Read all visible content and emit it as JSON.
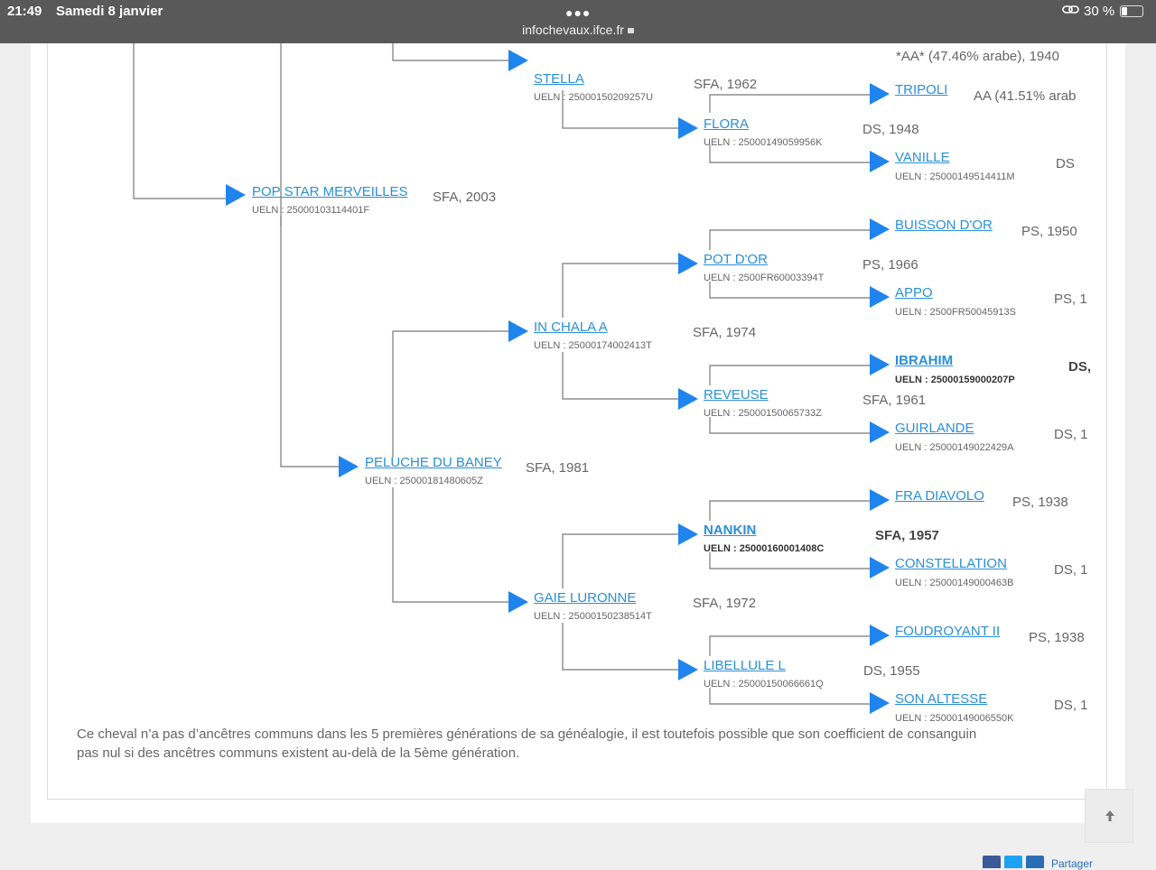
{
  "status_bar": {
    "time": "21:49",
    "date": "Samedi 8 janvier",
    "url": "infochevaux.ifce.fr",
    "battery": "30 %"
  },
  "pedigree": {
    "stella": {
      "name": "STELLA",
      "ueln": "UELN : 25000150209257U",
      "info": "SFA, 1962"
    },
    "aa_top": {
      "info": "*AA* (47.46% arabe), 1940"
    },
    "tripoli": {
      "name": "TRIPOLI",
      "info": "AA (41.51% arab"
    },
    "flora": {
      "name": "FLORA",
      "ueln": "UELN : 25000149059956K",
      "info": "DS, 1948"
    },
    "vanille": {
      "name": "VANILLE",
      "ueln": "UELN : 25000149514411M",
      "info": "DS"
    },
    "pop_star": {
      "name": "POP STAR MERVEILLES",
      "ueln": "UELN : 25000103114401F",
      "info": "SFA, 2003"
    },
    "buisson": {
      "name": "BUISSON D'OR",
      "info": "PS, 1950"
    },
    "pot_dor": {
      "name": "POT D'OR",
      "ueln": "UELN : 2500FR60003394T",
      "info": "PS, 1966"
    },
    "appo": {
      "name": "APPO",
      "ueln": "UELN : 2500FR50045913S",
      "info": "PS, 1"
    },
    "in_chala": {
      "name": "IN CHALA A",
      "ueln": "UELN : 25000174002413T",
      "info": "SFA, 1974"
    },
    "ibrahim": {
      "name": "IBRAHIM",
      "ueln": "UELN : 25000159000207P",
      "info": "DS,"
    },
    "reveuse": {
      "name": "REVEUSE",
      "ueln": "UELN : 25000150065733Z",
      "info": "SFA, 1961"
    },
    "guirlande": {
      "name": "GUIRLANDE",
      "ueln": "UELN : 25000149022429A",
      "info": "DS, 1"
    },
    "peluche": {
      "name": "PELUCHE DU BANEY",
      "ueln": "UELN : 25000181480605Z",
      "info": "SFA, 1981"
    },
    "fra_diavolo": {
      "name": "FRA DIAVOLO",
      "info": "PS, 1938"
    },
    "nankin": {
      "name": "NANKIN",
      "ueln": "UELN : 25000160001408C",
      "info": "SFA, 1957"
    },
    "constellation": {
      "name": "CONSTELLATION",
      "ueln": "UELN : 25000149000463B",
      "info": "DS, 1"
    },
    "gaie": {
      "name": "GAIE LURONNE",
      "ueln": "UELN : 25000150238514T",
      "info": "SFA, 1972"
    },
    "foudroyant": {
      "name": "FOUDROYANT II",
      "info": "PS, 1938"
    },
    "libellule": {
      "name": "LIBELLULE L",
      "ueln": "UELN : 25000150066661Q",
      "info": "DS, 1955"
    },
    "son_altesse": {
      "name": "SON ALTESSE",
      "ueln": "UELN : 25000149006550K",
      "info": "DS, 1"
    }
  },
  "note": {
    "line1": "Ce cheval n’a pas d’ancêtres communs dans les 5 premières générations de sa généalogie, il est toutefois possible que son coefficient de consanguin",
    "line2": "pas nul si des ancêtres communs existent au-delà de la 5ème génération."
  },
  "share": {
    "label": "Partager"
  },
  "colors": {
    "link": "#2a8fd6",
    "arrow": "#1f84ee",
    "status_bar": "#595959"
  }
}
